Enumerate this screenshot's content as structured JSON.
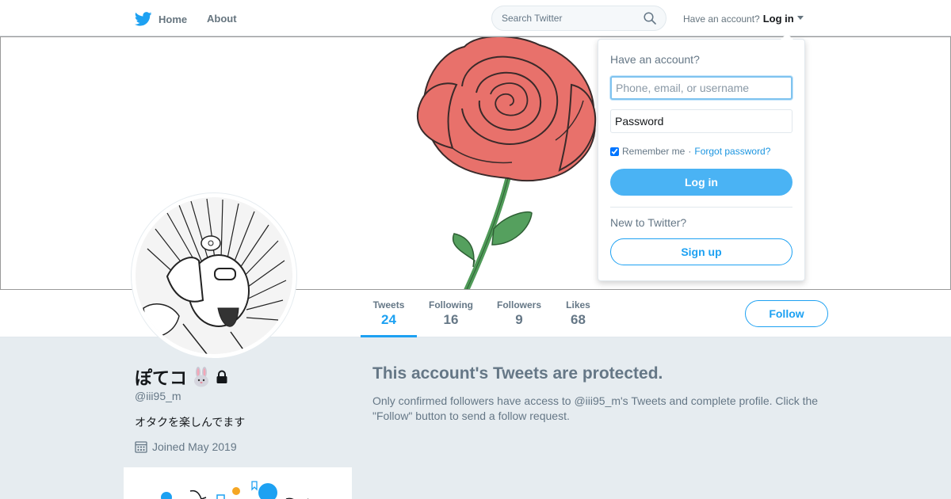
{
  "nav": {
    "home_label": "Home",
    "about_label": "About",
    "search_placeholder": "Search Twitter",
    "have_account": "Have an account?",
    "login_label": "Log in"
  },
  "profile": {
    "name": "ぽてコ",
    "handle": "@iii95_m",
    "bio": "オタクを楽しんでます",
    "joined": "Joined May 2019"
  },
  "stats": [
    {
      "label": "Tweets",
      "value": "24"
    },
    {
      "label": "Following",
      "value": "16"
    },
    {
      "label": "Followers",
      "value": "9"
    },
    {
      "label": "Likes",
      "value": "68"
    }
  ],
  "follow_label": "Follow",
  "protected": {
    "title": "This account's Tweets are protected.",
    "text": "Only confirmed followers have access to @iii95_m's Tweets and complete profile. Click the \"Follow\" button to send a follow request."
  },
  "login_dropdown": {
    "heading": "Have an account?",
    "username_placeholder": "Phone, email, or username",
    "password_placeholder": "Password",
    "remember": "Remember me",
    "separator": "·",
    "forgot": "Forgot password?",
    "login_button": "Log in",
    "new_heading": "New to Twitter?",
    "signup_button": "Sign up"
  },
  "colors": {
    "brand": "#1da1f2",
    "rose": "#e8716b",
    "leaf": "#4f9a58"
  }
}
